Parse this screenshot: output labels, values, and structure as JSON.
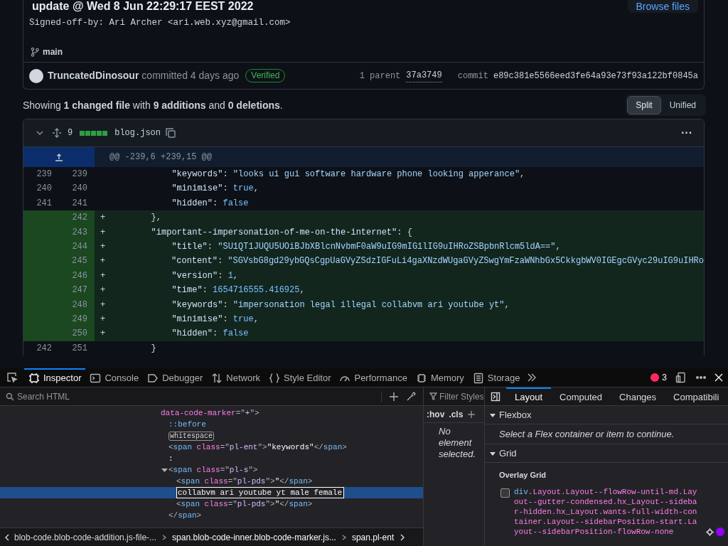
{
  "commit": {
    "title": "update @ Wed 8 Jun 22:29:17 EEST 2022",
    "browse_button": "Browse files",
    "signoff": "Signed-off-by: Ari Archer <ari.web.xyz@gmail.com>",
    "branch": "main",
    "author": "TruncatedDinosour",
    "action": "committed 4 days ago",
    "badge": "Verified",
    "parents_label": "1 parent",
    "parent_hash": "37a3749",
    "commit_label": "commit",
    "commit_hash": "e89c381e5566eed3fe64a93e73f93a122bf0845a"
  },
  "summary": {
    "text": "Showing **1 changed file** with **9 additions** and **0 deletions**.",
    "view_toggle": [
      {
        "label": "Split",
        "selected": true
      },
      {
        "label": "Unified",
        "selected": false
      }
    ]
  },
  "file": {
    "changes": "9",
    "name": "blog.json",
    "menu": "···",
    "hunk": "@@ -239,6 +239,15 @@",
    "lines": [
      {
        "kind": "context",
        "old": "239",
        "new": "239",
        "tokens": [
          {
            "kind": "key",
            "text": "            \"keywords\""
          },
          {
            "kind": "punct",
            "text": ": "
          },
          {
            "kind": "string",
            "text": "\"looks ui gui software hardware phone looking apperance\""
          },
          {
            "kind": "punct",
            "text": ","
          }
        ]
      },
      {
        "kind": "context",
        "old": "240",
        "new": "240",
        "tokens": [
          {
            "kind": "key",
            "text": "            \"minimise\""
          },
          {
            "kind": "punct",
            "text": ": "
          },
          {
            "kind": "constant",
            "text": "true"
          },
          {
            "kind": "punct",
            "text": ","
          }
        ]
      },
      {
        "kind": "context",
        "old": "241",
        "new": "241",
        "tokens": [
          {
            "kind": "key",
            "text": "            \"hidden\""
          },
          {
            "kind": "punct",
            "text": ": "
          },
          {
            "kind": "constant",
            "text": "false"
          }
        ]
      },
      {
        "kind": "addition",
        "new": "242",
        "marker": "+",
        "tokens": [
          {
            "kind": "punct",
            "text": "        },"
          }
        ]
      },
      {
        "kind": "addition",
        "new": "243",
        "marker": "+",
        "tokens": [
          {
            "kind": "key",
            "text": "        \"important--impersonation-of-me-on-the-internet\""
          },
          {
            "kind": "punct",
            "text": ": {"
          }
        ]
      },
      {
        "kind": "addition",
        "new": "244",
        "marker": "+",
        "tokens": [
          {
            "kind": "key",
            "text": "            \"title\""
          },
          {
            "kind": "punct",
            "text": ": "
          },
          {
            "kind": "string",
            "text": "\"SU1QT1JUQU5UOiBJbXBlcnNvbmF0aW9uIG9mIG1lIG9uIHRoZSBpbnRlcm5ldA==\""
          },
          {
            "kind": "punct",
            "text": ","
          }
        ]
      },
      {
        "kind": "addition",
        "new": "245",
        "marker": "+",
        "tokens": [
          {
            "kind": "key",
            "text": "            \"content\""
          },
          {
            "kind": "punct",
            "text": ": "
          },
          {
            "kind": "string",
            "text": "\"SGVsbG8gd29ybGQsCgpUaGVyZSdzIGFuLi4gaXNzdWUgaGVyZSwgYmFzaWNhbGx5CkkgbWV0IGEgcGVyc29uIG9uIHRo"
          }
        ]
      },
      {
        "kind": "addition",
        "new": "246",
        "marker": "+",
        "tokens": [
          {
            "kind": "key",
            "text": "            \"version\""
          },
          {
            "kind": "punct",
            "text": ": "
          },
          {
            "kind": "constant",
            "text": "1"
          },
          {
            "kind": "punct",
            "text": ","
          }
        ]
      },
      {
        "kind": "addition",
        "new": "247",
        "marker": "+",
        "tokens": [
          {
            "kind": "key",
            "text": "            \"time\""
          },
          {
            "kind": "punct",
            "text": ": "
          },
          {
            "kind": "constant",
            "text": "1654716555.416925"
          },
          {
            "kind": "punct",
            "text": ","
          }
        ]
      },
      {
        "kind": "addition",
        "new": "248",
        "marker": "+",
        "tokens": [
          {
            "kind": "key",
            "text": "            \"keywords\""
          },
          {
            "kind": "punct",
            "text": ": "
          },
          {
            "kind": "string",
            "text": "\"impersonation legal illegal collabvm ari youtube yt\""
          },
          {
            "kind": "punct",
            "text": ","
          }
        ]
      },
      {
        "kind": "addition",
        "new": "249",
        "marker": "+",
        "tokens": [
          {
            "kind": "key",
            "text": "            \"minimise\""
          },
          {
            "kind": "punct",
            "text": ": "
          },
          {
            "kind": "constant",
            "text": "true"
          },
          {
            "kind": "punct",
            "text": ","
          }
        ]
      },
      {
        "kind": "addition",
        "new": "250",
        "marker": "+",
        "tokens": [
          {
            "kind": "key",
            "text": "            \"hidden\""
          },
          {
            "kind": "punct",
            "text": ": "
          },
          {
            "kind": "constant",
            "text": "false"
          }
        ]
      },
      {
        "kind": "context",
        "old": "242",
        "new": "251",
        "tokens": [
          {
            "kind": "punct",
            "text": "        }"
          }
        ]
      }
    ]
  },
  "devtools": {
    "tabs": [
      {
        "label": "Inspector",
        "selected": true
      },
      {
        "label": "Console",
        "selected": false
      },
      {
        "label": "Debugger",
        "selected": false
      },
      {
        "label": "Network",
        "selected": false
      },
      {
        "label": "Style Editor",
        "selected": false
      },
      {
        "label": "Performance",
        "selected": false
      },
      {
        "label": "Memory",
        "selected": false
      },
      {
        "label": "Storage",
        "selected": false
      }
    ],
    "error_count": "3",
    "search": {
      "placeholder": "Search HTML"
    },
    "markup": [
      {
        "tokens": [
          {
            "kind": "attr",
            "text": "data-code-marker"
          },
          {
            "kind": "punct",
            "text": "=\""
          },
          {
            "kind": "value",
            "text": "+"
          },
          {
            "kind": "punct",
            "text": "\">"
          }
        ],
        "children": [
          {
            "tokens": [
              {
                "kind": "pseudo",
                "text": "::before"
              }
            ]
          },
          {
            "tokens": [
              {
                "kind": "badge",
                "text": "whitespace"
              }
            ]
          },
          {
            "tokens": [
              {
                "kind": "punct",
                "text": "<"
              },
              {
                "kind": "tag",
                "text": "span"
              },
              {
                "kind": "attr",
                "text": " class"
              },
              {
                "kind": "punct",
                "text": "=\""
              },
              {
                "kind": "value",
                "text": "pl-ent"
              },
              {
                "kind": "punct",
                "text": "\">"
              },
              {
                "kind": "text",
                "text": "\"keywords\""
              },
              {
                "kind": "punct",
                "text": "</"
              },
              {
                "kind": "tag",
                "text": "span"
              },
              {
                "kind": "punct",
                "text": ">"
              }
            ]
          },
          {
            "tokens": [
              {
                "kind": "text",
                "text": ":"
              }
            ]
          },
          {
            "expanded": true,
            "tokens": [
              {
                "kind": "punct",
                "text": "<"
              },
              {
                "kind": "tag",
                "text": "span"
              },
              {
                "kind": "attr",
                "text": " class"
              },
              {
                "kind": "punct",
                "text": "=\""
              },
              {
                "kind": "value",
                "text": "pl-s"
              },
              {
                "kind": "punct",
                "text": "\">"
              }
            ],
            "children": [
              {
                "tokens": [
                  {
                    "kind": "punct",
                    "text": "<"
                  },
                  {
                    "kind": "tag",
                    "text": "span"
                  },
                  {
                    "kind": "attr",
                    "text": " class"
                  },
                  {
                    "kind": "punct",
                    "text": "=\""
                  },
                  {
                    "kind": "value",
                    "text": "pl-pds"
                  },
                  {
                    "kind": "punct",
                    "text": "\">"
                  },
                  {
                    "kind": "text",
                    "text": "\""
                  },
                  {
                    "kind": "punct",
                    "text": "</"
                  },
                  {
                    "kind": "tag",
                    "text": "span"
                  },
                  {
                    "kind": "punct",
                    "text": ">"
                  }
                ]
              },
              {
                "kind": "editor",
                "selected": true,
                "value": "collabvm ari youtube yt male female"
              },
              {
                "tokens": [
                  {
                    "kind": "punct",
                    "text": "<"
                  },
                  {
                    "kind": "tag",
                    "text": "span"
                  },
                  {
                    "kind": "attr",
                    "text": " class"
                  },
                  {
                    "kind": "punct",
                    "text": "=\""
                  },
                  {
                    "kind": "value",
                    "text": "pl-pds"
                  },
                  {
                    "kind": "punct",
                    "text": "\">"
                  },
                  {
                    "kind": "text",
                    "text": "\""
                  },
                  {
                    "kind": "punct",
                    "text": "</"
                  },
                  {
                    "kind": "tag",
                    "text": "span"
                  },
                  {
                    "kind": "punct",
                    "text": ">"
                  }
                ]
              }
            ],
            "closing": [
              {
                "kind": "punct",
                "text": "</"
              },
              {
                "kind": "tag",
                "text": "span"
              },
              {
                "kind": "punct",
                "text": ">"
              }
            ]
          }
        ]
      }
    ],
    "breadcrumbs": [
      "blob-code.blob-code-addition.js-file-...",
      "span.blob-code-inner.blob-code-marker.js...",
      "span.pl-ent"
    ],
    "rules": {
      "filter": {
        "placeholder": "Filter Styles"
      },
      "hov": ":hov",
      "cls": ".cls",
      "empty": "No element selected."
    },
    "layout_tabs": [
      {
        "label": "Layout",
        "selected": true
      },
      {
        "label": "Computed",
        "selected": false
      },
      {
        "label": "Changes",
        "selected": false
      },
      {
        "label": "Compatibili",
        "selected": false
      }
    ],
    "flexbox": {
      "title": "Flexbox",
      "expanded": true,
      "message": "Select a Flex container or item to continue."
    },
    "grid": {
      "title": "Grid",
      "expanded": true,
      "overlay_title": "Overlay Grid",
      "items": [
        {
          "tag": "div",
          "classes": ".Layout.Layout--flowRow-until-md.Layout--gutter-condensed.hx_Layout--sidebar-hidden.hx_Layout.wants-full-width-container.Layout--sidebarPosition-start.Layout--sidebarPosition-flowRow-none",
          "checked": false,
          "color": "#9400ff"
        }
      ]
    }
  }
}
